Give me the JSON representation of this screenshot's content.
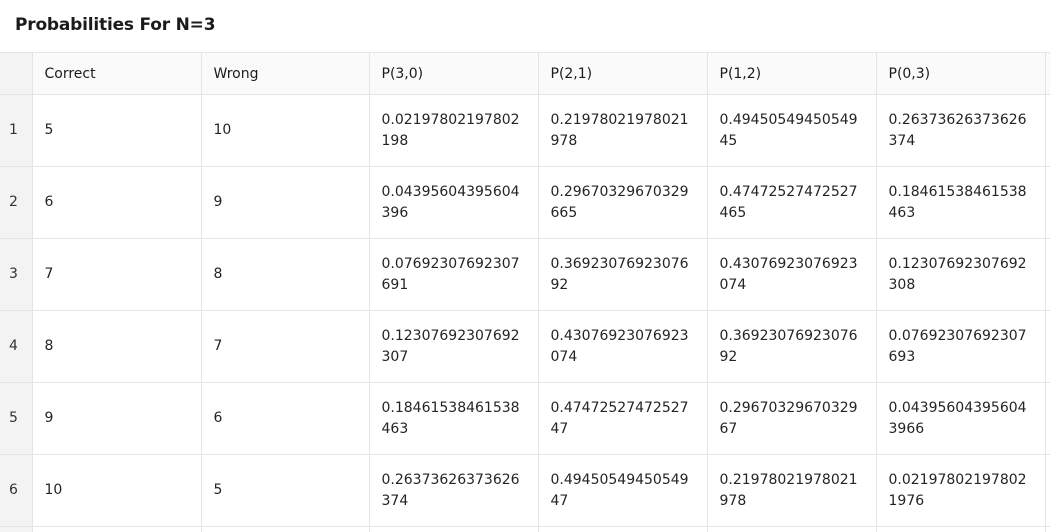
{
  "title": "Probabilities For N=3",
  "table": {
    "columns": [
      "Correct",
      "Wrong",
      "P(3,0)",
      "P(2,1)",
      "P(1,2)",
      "P(0,3)"
    ],
    "rows": [
      {
        "index": "1",
        "correct": "5",
        "wrong": "10",
        "p30": "0.02197802197802198",
        "p21": "0.21978021978021978",
        "p12": "0.4945054945054945",
        "p03": "0.26373626373626374"
      },
      {
        "index": "2",
        "correct": "6",
        "wrong": "9",
        "p30": "0.04395604395604396",
        "p21": "0.29670329670329665",
        "p12": "0.47472527472527465",
        "p03": "0.18461538461538463"
      },
      {
        "index": "3",
        "correct": "7",
        "wrong": "8",
        "p30": "0.07692307692307691",
        "p21": "0.3692307692307692",
        "p12": "0.43076923076923074",
        "p03": "0.12307692307692308"
      },
      {
        "index": "4",
        "correct": "8",
        "wrong": "7",
        "p30": "0.12307692307692307",
        "p21": "0.43076923076923074",
        "p12": "0.3692307692307692",
        "p03": "0.07692307692307693"
      },
      {
        "index": "5",
        "correct": "9",
        "wrong": "6",
        "p30": "0.18461538461538463",
        "p21": "0.4747252747252747",
        "p12": "0.2967032967032967",
        "p03": "0.043956043956043966"
      },
      {
        "index": "6",
        "correct": "10",
        "wrong": "5",
        "p30": "0.26373626373626374",
        "p21": "0.4945054945054947",
        "p12": "0.21978021978021978",
        "p03": "0.021978021978021976"
      }
    ]
  }
}
